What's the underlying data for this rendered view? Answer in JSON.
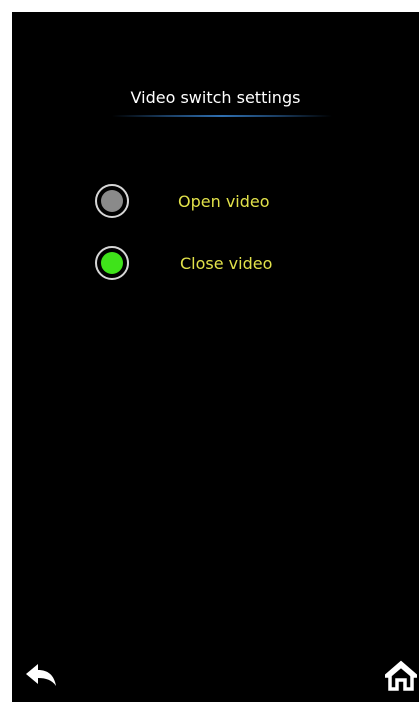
{
  "header": {
    "title": "Video switch settings"
  },
  "options": [
    {
      "label": "Open video",
      "selected": false
    },
    {
      "label": "Close video",
      "selected": true
    }
  ],
  "footer": {
    "back_icon": "back-arrow-icon",
    "home_icon": "home-icon"
  },
  "colors": {
    "background": "#000000",
    "title_text": "#ffffff",
    "option_text": "#e2e24a",
    "radio_selected": "#3fe31a",
    "radio_unselected": "#8a8a8a",
    "accent_line": "#2f6fb0"
  }
}
